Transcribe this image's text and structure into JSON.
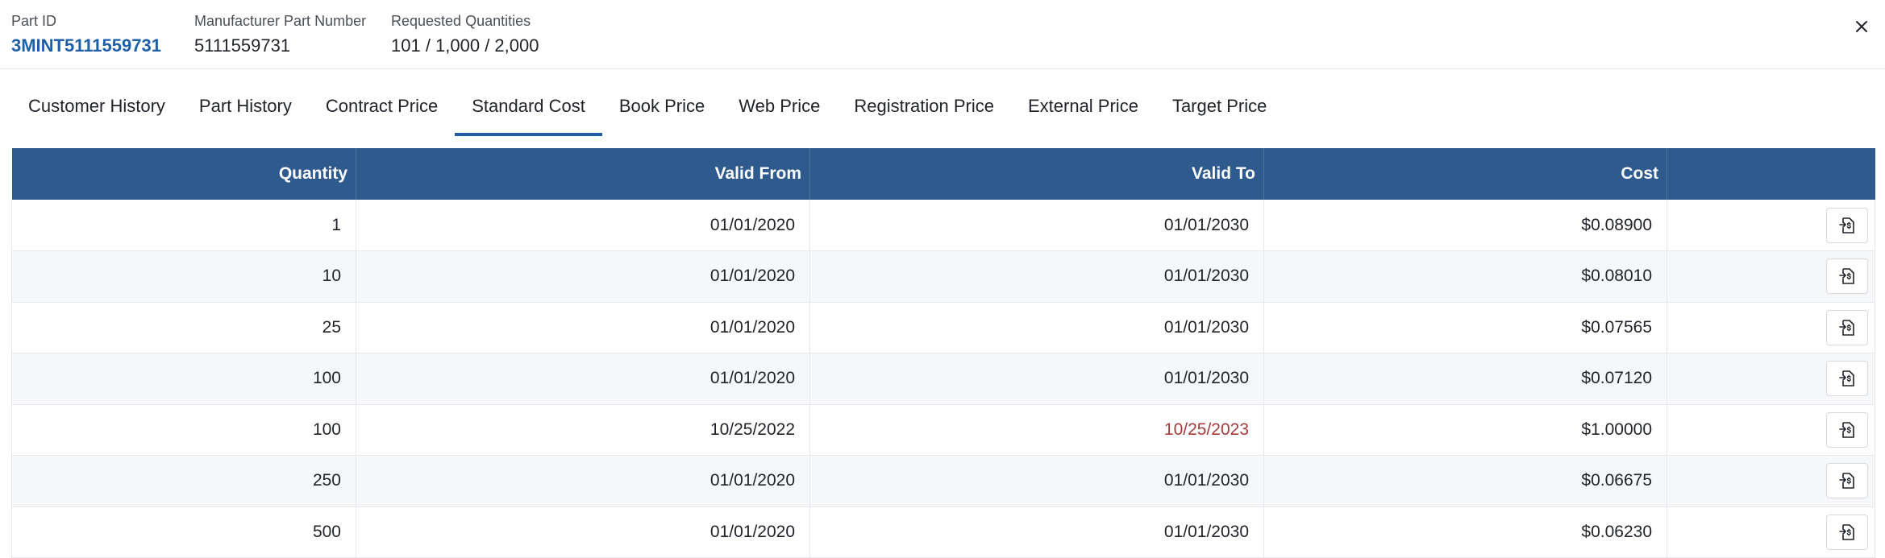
{
  "header": {
    "part_id_label": "Part ID",
    "part_id_value": "3MINT5111559731",
    "mfr_label": "Manufacturer Part Number",
    "mfr_value": "5111559731",
    "qty_label": "Requested Quantities",
    "qty_value": "101 / 1,000 / 2,000",
    "close_icon": "close-icon"
  },
  "tabs": [
    {
      "label": "Customer History",
      "active": false
    },
    {
      "label": "Part History",
      "active": false
    },
    {
      "label": "Contract Price",
      "active": false
    },
    {
      "label": "Standard Cost",
      "active": true
    },
    {
      "label": "Book Price",
      "active": false
    },
    {
      "label": "Web Price",
      "active": false
    },
    {
      "label": "Registration Price",
      "active": false
    },
    {
      "label": "External Price",
      "active": false
    },
    {
      "label": "Target Price",
      "active": false
    }
  ],
  "table": {
    "columns": [
      "Quantity",
      "Valid From",
      "Valid To",
      "Cost",
      ""
    ],
    "rows": [
      {
        "quantity": "1",
        "valid_from": "01/01/2020",
        "valid_to": "01/01/2030",
        "cost": "$0.08900",
        "expired": false
      },
      {
        "quantity": "10",
        "valid_from": "01/01/2020",
        "valid_to": "01/01/2030",
        "cost": "$0.08010",
        "expired": false
      },
      {
        "quantity": "25",
        "valid_from": "01/01/2020",
        "valid_to": "01/01/2030",
        "cost": "$0.07565",
        "expired": false
      },
      {
        "quantity": "100",
        "valid_from": "01/01/2020",
        "valid_to": "01/01/2030",
        "cost": "$0.07120",
        "expired": false
      },
      {
        "quantity": "100",
        "valid_from": "10/25/2022",
        "valid_to": "10/25/2023",
        "cost": "$1.00000",
        "expired": true
      },
      {
        "quantity": "250",
        "valid_from": "01/01/2020",
        "valid_to": "01/01/2030",
        "cost": "$0.06675",
        "expired": false
      },
      {
        "quantity": "500",
        "valid_from": "01/01/2020",
        "valid_to": "01/01/2030",
        "cost": "$0.06230",
        "expired": false
      }
    ],
    "row_action_icon": "apply-price-icon"
  },
  "colors": {
    "accent": "#1f5fa8",
    "header_bg": "#2e5a8e",
    "expired_text": "#a93a3a"
  }
}
